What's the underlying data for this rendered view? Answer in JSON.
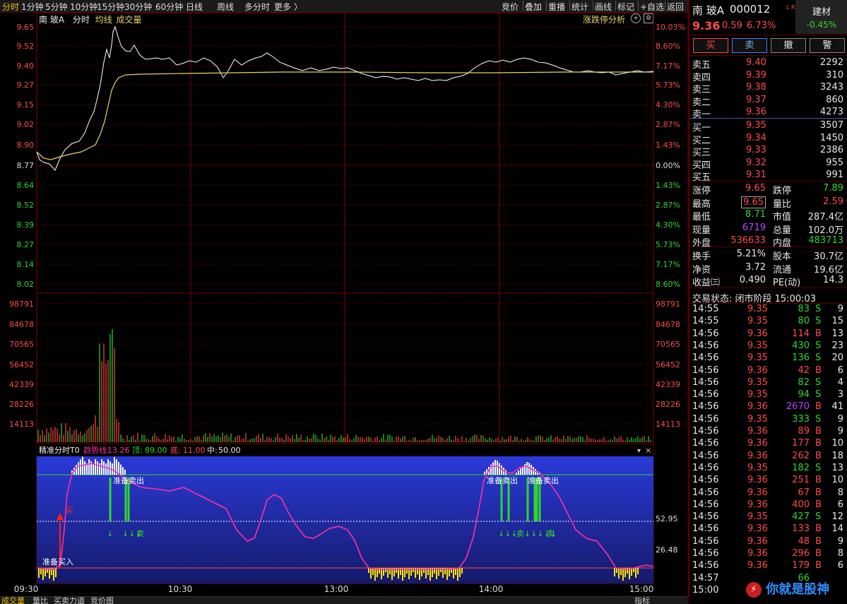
{
  "topbar": {
    "periods": [
      "分时",
      "1分钟",
      "5分钟",
      "10分钟",
      "15分钟",
      "30分钟",
      "60分钟",
      "日线",
      "周线",
      "多分时",
      "更多 〉"
    ],
    "tools": [
      "竞价",
      "叠加",
      "重播",
      "统计",
      "画线",
      "标记",
      "+自选",
      "返回"
    ]
  },
  "chart_header": {
    "stock": "南 玻A",
    "mode": "分时",
    "avg_label": "均线",
    "vol_label": "成交量",
    "limit_analysis": "涨跌停分析"
  },
  "price_axis": {
    "left": [
      "9.65",
      "9.52",
      "9.40",
      "9.27",
      "9.15",
      "9.02",
      "8.90",
      "8.77",
      "8.64",
      "8.52",
      "8.39",
      "8.27",
      "8.14",
      "8.02"
    ],
    "right": [
      "10.03%",
      "8.60%",
      "7.17%",
      "5.73%",
      "4.30%",
      "2.87%",
      "1.43%",
      "0.00%",
      "1.43%",
      "2.87%",
      "4.30%",
      "5.73%",
      "7.17%",
      "8.60%"
    ]
  },
  "volume_axis": [
    "98791",
    "84678",
    "70565",
    "56452",
    "42339",
    "28226",
    "14113"
  ],
  "indicator": {
    "name": "精准分时T0",
    "trend_label": "趋势线:",
    "trend_value": "13.26",
    "top_label": "顶:",
    "top_value": "89.00",
    "bottom_label": "底:",
    "bottom_value": "11.00",
    "mid_label": "中:",
    "mid_value": "50.00",
    "axis": [
      "52.95",
      "26.48"
    ],
    "signals": {
      "prepare_sell": "准备卖出",
      "prepare_buy": "准备买入",
      "buy": "买",
      "sell": "卖"
    }
  },
  "time_axis": [
    "09:30",
    "10:30",
    "13:00",
    "14:00",
    "15:00"
  ],
  "bottom_tabs": [
    "成交量",
    "量比",
    "买卖力道",
    "竞价图",
    "指标"
  ],
  "colors": {
    "up": "#ff4a4a",
    "down": "#2fd62f",
    "price_line": "#ffffff",
    "avg_line": "#e8d46a",
    "trend_line": "#ff2fa0"
  },
  "quote": {
    "name": "南 玻A",
    "code": "000012",
    "tag": "L R500",
    "industry": "建材",
    "industry_change": "-0.45%",
    "price": "9.36",
    "change": "0.59",
    "change_pct": "6.73%",
    "buttons": [
      "买",
      "卖",
      "撤",
      "警"
    ],
    "asks": [
      {
        "label": "卖五",
        "price": "9.40",
        "vol": "2292"
      },
      {
        "label": "卖四",
        "price": "9.39",
        "vol": "310"
      },
      {
        "label": "卖三",
        "price": "9.38",
        "vol": "3243"
      },
      {
        "label": "卖二",
        "price": "9.37",
        "vol": "860"
      },
      {
        "label": "卖一",
        "price": "9.36",
        "vol": "4273"
      }
    ],
    "bids": [
      {
        "label": "买一",
        "price": "9.35",
        "vol": "3507"
      },
      {
        "label": "买二",
        "price": "9.34",
        "vol": "1450"
      },
      {
        "label": "买三",
        "price": "9.33",
        "vol": "2386"
      },
      {
        "label": "买四",
        "price": "9.32",
        "vol": "955"
      },
      {
        "label": "买五",
        "price": "9.31",
        "vol": "991"
      }
    ],
    "stats": [
      {
        "l1": "涨停",
        "v1": "9.65",
        "c1": "red",
        "l2": "跌停",
        "v2": "7.89",
        "c2": "green"
      },
      {
        "l1": "最高",
        "v1": "9.65",
        "c1": "red",
        "l2": "量比",
        "v2": "2.59",
        "c2": "red"
      },
      {
        "l1": "最低",
        "v1": "8.71",
        "c1": "green",
        "l2": "市值",
        "v2": "287.4亿",
        "c2": "white"
      },
      {
        "l1": "现量",
        "v1": "6719",
        "c1": "purple",
        "l2": "总量",
        "v2": "102.0万",
        "c2": "white"
      },
      {
        "l1": "外盘",
        "v1": "536633",
        "c1": "red",
        "l2": "内盘",
        "v2": "483713",
        "c2": "green"
      },
      {
        "l1": "换手",
        "v1": "5.21%",
        "c1": "white",
        "l2": "股本",
        "v2": "30.7亿",
        "c2": "white"
      },
      {
        "l1": "净资",
        "v1": "3.72",
        "c1": "white",
        "l2": "流通",
        "v2": "19.6亿",
        "c2": "white"
      },
      {
        "l1": "收益㈢",
        "v1": "0.490",
        "c1": "white",
        "l2": "PE(动)",
        "v2": "14.3",
        "c2": "white"
      }
    ],
    "trade_status": "交易状态: 闭市阶段 15:00:03",
    "ticks": [
      {
        "t": "14:55",
        "p": "9.35",
        "v": "83",
        "s": "S",
        "n": "9"
      },
      {
        "t": "14:55",
        "p": "9.35",
        "v": "80",
        "s": "S",
        "n": "15"
      },
      {
        "t": "14:56",
        "p": "9.36",
        "v": "114",
        "s": "B",
        "n": "13"
      },
      {
        "t": "14:56",
        "p": "9.35",
        "v": "430",
        "s": "S",
        "n": "23"
      },
      {
        "t": "14:56",
        "p": "9.35",
        "v": "136",
        "s": "S",
        "n": "20"
      },
      {
        "t": "14:56",
        "p": "9.36",
        "v": "42",
        "s": "B",
        "n": "6"
      },
      {
        "t": "14:56",
        "p": "9.35",
        "v": "82",
        "s": "S",
        "n": "4"
      },
      {
        "t": "14:56",
        "p": "9.35",
        "v": "94",
        "s": "S",
        "n": "3"
      },
      {
        "t": "14:56",
        "p": "9.36",
        "v": "2670",
        "s": "B",
        "n": "41"
      },
      {
        "t": "14:56",
        "p": "9.35",
        "v": "333",
        "s": "S",
        "n": "9"
      },
      {
        "t": "14:56",
        "p": "9.36",
        "v": "89",
        "s": "B",
        "n": "9"
      },
      {
        "t": "14:56",
        "p": "9.36",
        "v": "177",
        "s": "B",
        "n": "10"
      },
      {
        "t": "14:56",
        "p": "9.36",
        "v": "262",
        "s": "B",
        "n": "18"
      },
      {
        "t": "14:56",
        "p": "9.35",
        "v": "182",
        "s": "S",
        "n": "13"
      },
      {
        "t": "14:56",
        "p": "9.36",
        "v": "251",
        "s": "B",
        "n": "10"
      },
      {
        "t": "14:56",
        "p": "9.36",
        "v": "67",
        "s": "B",
        "n": "8"
      },
      {
        "t": "14:56",
        "p": "9.36",
        "v": "400",
        "s": "B",
        "n": "6"
      },
      {
        "t": "14:56",
        "p": "9.35",
        "v": "427",
        "s": "S",
        "n": "12"
      },
      {
        "t": "14:56",
        "p": "9.36",
        "v": "133",
        "s": "B",
        "n": "14"
      },
      {
        "t": "14:56",
        "p": "9.36",
        "v": "48",
        "s": "B",
        "n": "9"
      },
      {
        "t": "14:56",
        "p": "9.36",
        "v": "296",
        "s": "B",
        "n": "8"
      },
      {
        "t": "14:56",
        "p": "9.36",
        "v": "179",
        "s": "B",
        "n": "6"
      },
      {
        "t": "14:57",
        "p": "",
        "v": "66",
        "s": "",
        "n": ""
      },
      {
        "t": "15:00",
        "p": "",
        "v": "",
        "s": "",
        "n": ""
      }
    ],
    "watermark": "你就是股神"
  }
}
